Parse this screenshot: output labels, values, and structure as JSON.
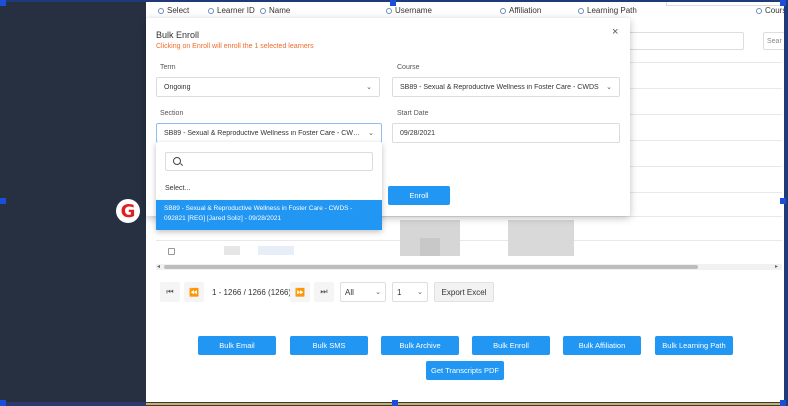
{
  "table": {
    "columns": [
      "Select",
      "Learner ID",
      "Name",
      "Username",
      "Affiliation",
      "Learning Path",
      "Course"
    ],
    "search_placeholder": "Sear"
  },
  "modal": {
    "title": "Bulk Enroll",
    "subtitle": "Clicking on Enroll will enroll the 1 selected learners",
    "close_icon": "×",
    "term_label": "Term",
    "term_value": "Ongoing",
    "course_label": "Course",
    "course_value": "SB89 - Sexual & Reproductive Wellness in Foster Care - CWDS",
    "section_label": "Section",
    "section_value": "SB89 - Sexual & Reproductive Wellness in Foster Care - CWDS...",
    "start_date_label": "Start Date",
    "start_date_value": "09/28/2021",
    "enroll_label": "Enroll"
  },
  "dropdown": {
    "select_placeholder": "Select...",
    "option_line1": "SB89 - Sexual & Reproductive Wellness in Foster Care - CWDS -",
    "option_line2": "092821 [REG] [Jared Soliz] - 09/28/2021"
  },
  "pager": {
    "first": "⏮",
    "prev": "⏪",
    "info": "1 - 1266 / 1266 (1266)",
    "next": "⏩",
    "last": "⏭",
    "page_size": "All",
    "page": "1",
    "export_label": "Export Excel"
  },
  "actions": {
    "bulk_email": "Bulk Email",
    "bulk_sms": "Bulk SMS",
    "bulk_archive": "Bulk Archive",
    "bulk_enroll": "Bulk Enroll",
    "bulk_affiliation": "Bulk Affiliation",
    "bulk_learning_path": "Bulk Learning Path",
    "transcripts_pdf": "Get Transcripts PDF"
  },
  "marker": {
    "letter": "G"
  },
  "colors": {
    "primary": "#2196f3",
    "sidebar": "#263040",
    "warning_text": "#f26b2a",
    "marker": "#e02020"
  }
}
